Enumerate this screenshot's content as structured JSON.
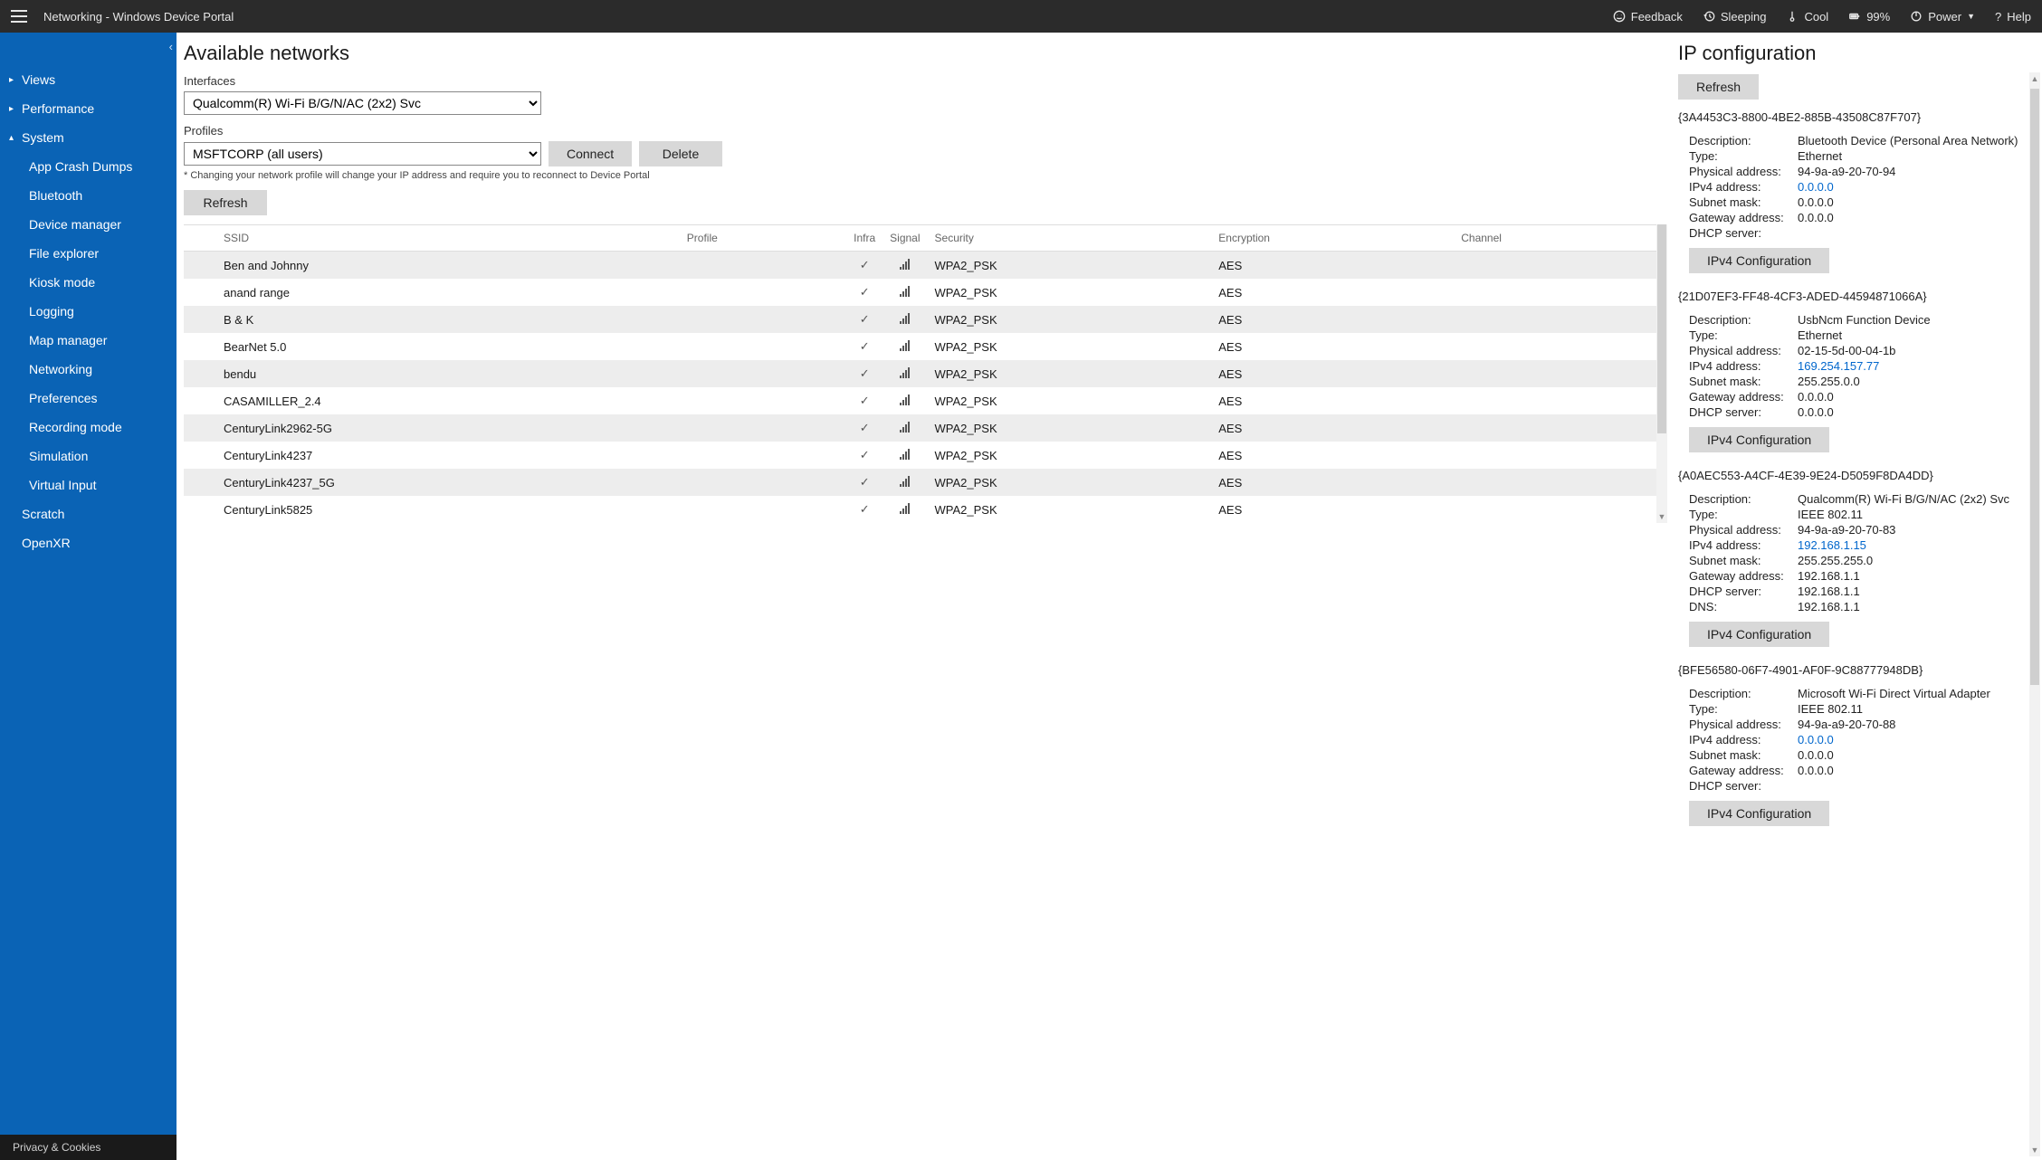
{
  "topbar": {
    "title": "Networking - Windows Device Portal",
    "feedback": "Feedback",
    "sleeping": "Sleeping",
    "cool": "Cool",
    "battery": "99%",
    "power": "Power",
    "help": "Help"
  },
  "sidebar": {
    "views": "Views",
    "performance": "Performance",
    "system": "System",
    "system_children": [
      "App Crash Dumps",
      "Bluetooth",
      "Device manager",
      "File explorer",
      "Kiosk mode",
      "Logging",
      "Map manager",
      "Networking",
      "Preferences",
      "Recording mode",
      "Simulation",
      "Virtual Input"
    ],
    "scratch": "Scratch",
    "openxr": "OpenXR",
    "footer": "Privacy & Cookies"
  },
  "left": {
    "heading": "Available networks",
    "interfaces_label": "Interfaces",
    "interfaces_value": "Qualcomm(R) Wi-Fi B/G/N/AC (2x2) Svc",
    "profiles_label": "Profiles",
    "profiles_value": "MSFTCORP (all users)",
    "connect": "Connect",
    "delete": "Delete",
    "hint": "* Changing your network profile will change your IP address and require you to reconnect to Device Portal",
    "refresh": "Refresh",
    "cols": [
      "",
      "SSID",
      "Profile",
      "Infra",
      "Signal",
      "Security",
      "Encryption",
      "Channel"
    ],
    "rows": [
      {
        "ssid": "Ben and Johnny",
        "profile": "",
        "infra": true,
        "security": "WPA2_PSK",
        "encryption": "AES"
      },
      {
        "ssid": "anand range",
        "profile": "",
        "infra": true,
        "security": "WPA2_PSK",
        "encryption": "AES"
      },
      {
        "ssid": "B & K",
        "profile": "",
        "infra": true,
        "security": "WPA2_PSK",
        "encryption": "AES"
      },
      {
        "ssid": "BearNet 5.0",
        "profile": "",
        "infra": true,
        "security": "WPA2_PSK",
        "encryption": "AES"
      },
      {
        "ssid": "bendu",
        "profile": "",
        "infra": true,
        "security": "WPA2_PSK",
        "encryption": "AES"
      },
      {
        "ssid": "CASAMILLER_2.4",
        "profile": "",
        "infra": true,
        "security": "WPA2_PSK",
        "encryption": "AES"
      },
      {
        "ssid": "CenturyLink2962-5G",
        "profile": "",
        "infra": true,
        "security": "WPA2_PSK",
        "encryption": "AES"
      },
      {
        "ssid": "CenturyLink4237",
        "profile": "",
        "infra": true,
        "security": "WPA2_PSK",
        "encryption": "AES"
      },
      {
        "ssid": "CenturyLink4237_5G",
        "profile": "",
        "infra": true,
        "security": "WPA2_PSK",
        "encryption": "AES"
      },
      {
        "ssid": "CenturyLink5825",
        "profile": "",
        "infra": true,
        "security": "WPA2_PSK",
        "encryption": "AES"
      }
    ]
  },
  "right": {
    "heading": "IP configuration",
    "refresh": "Refresh",
    "ipv4_btn": "IPv4 Configuration",
    "labels": {
      "description": "Description:",
      "type": "Type:",
      "physical": "Physical address:",
      "ipv4": "IPv4 address:",
      "subnet": "Subnet mask:",
      "gateway": "Gateway address:",
      "dhcp": "DHCP server:",
      "dns": "DNS:"
    },
    "adapters": [
      {
        "guid": "{3A4453C3-8800-4BE2-885B-43508C87F707}",
        "description": "Bluetooth Device (Personal Area Network)",
        "type": "Ethernet",
        "physical": "94-9a-a9-20-70-94",
        "ipv4": "0.0.0.0",
        "subnet": "0.0.0.0",
        "gateway": "0.0.0.0",
        "dhcp": ""
      },
      {
        "guid": "{21D07EF3-FF48-4CF3-ADED-44594871066A}",
        "description": "UsbNcm Function Device",
        "type": "Ethernet",
        "physical": "02-15-5d-00-04-1b",
        "ipv4": "169.254.157.77",
        "subnet": "255.255.0.0",
        "gateway": "0.0.0.0",
        "dhcp": "0.0.0.0"
      },
      {
        "guid": "{A0AEC553-A4CF-4E39-9E24-D5059F8DA4DD}",
        "description": "Qualcomm(R) Wi-Fi B/G/N/AC (2x2) Svc",
        "type": "IEEE 802.11",
        "physical": "94-9a-a9-20-70-83",
        "ipv4": "192.168.1.15",
        "subnet": "255.255.255.0",
        "gateway": "192.168.1.1",
        "dhcp": "192.168.1.1",
        "dns": "192.168.1.1"
      },
      {
        "guid": "{BFE56580-06F7-4901-AF0F-9C88777948DB}",
        "description": "Microsoft Wi-Fi Direct Virtual Adapter",
        "type": "IEEE 802.11",
        "physical": "94-9a-a9-20-70-88",
        "ipv4": "0.0.0.0",
        "subnet": "0.0.0.0",
        "gateway": "0.0.0.0",
        "dhcp": ""
      }
    ]
  }
}
